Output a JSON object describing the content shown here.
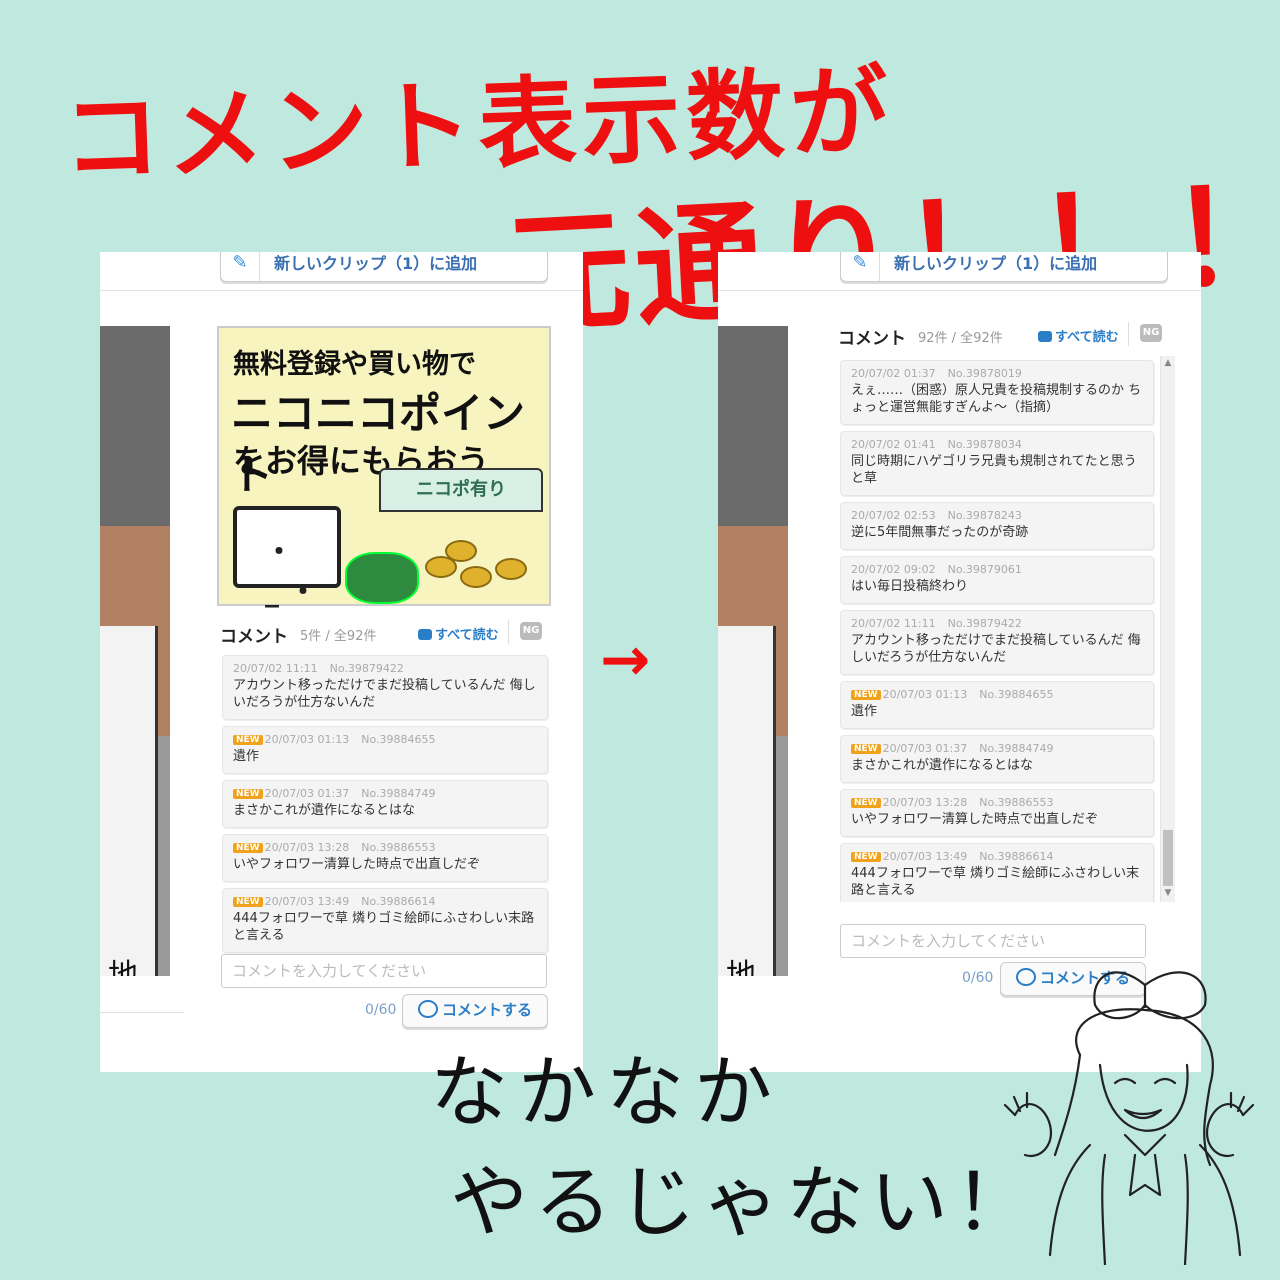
{
  "headline": {
    "line1": "コメント表示数が",
    "line2": "元通り！！！"
  },
  "panels": {
    "left": {
      "clip_label": "新しいクリップ（1）に追加",
      "manga_text": "地獄のそこで",
      "ad": {
        "line1": "無料登録や買い物で",
        "line2": "ニコニコポイント",
        "line3": "をお得にもらおう",
        "stall": "ニコポ有り"
      },
      "comment_header": {
        "label": "コメント",
        "count": "5件",
        "total": " / 全92件",
        "read_all": "すべて読む",
        "ng": "NG"
      },
      "comments": [
        {
          "date": "20/07/02 11:11",
          "no": "No.39879422",
          "new": "",
          "text": "アカウント移っただけでまだ投稿しているんだ 侮しいだろうが仕方ないんだ"
        },
        {
          "date": "20/07/03 01:13",
          "no": "No.39884655",
          "new": "NEW",
          "text": "遺作"
        },
        {
          "date": "20/07/03 01:37",
          "no": "No.39884749",
          "new": "NEW",
          "text": "まさかこれが遺作になるとはな"
        },
        {
          "date": "20/07/03 13:28",
          "no": "No.39886553",
          "new": "NEW",
          "text": "いやフォロワー清算した時点で出直しだぞ"
        },
        {
          "date": "20/07/03 13:49",
          "no": "No.39886614",
          "new": "NEW",
          "text": "444フォロワーで草 燐りゴミ絵師にふさわしい末路と言える"
        }
      ],
      "input_placeholder": "コメントを入力してください",
      "counter": "0/60",
      "submit": "コメントする"
    },
    "right": {
      "clip_label": "新しいクリップ（1）に追加",
      "manga_text": "地獄のそこで",
      "comment_header": {
        "label": "コメント",
        "count": "92件",
        "total": " / 全92件",
        "read_all": "すべて読む",
        "ng": "NG"
      },
      "comments": [
        {
          "date": "20/07/02 01:37",
          "no": "No.39878019",
          "new": "",
          "text": "えぇ……（困惑）原人兄貴を投稿規制するのか ちょっと運営無能すぎんよ～（指摘）"
        },
        {
          "date": "20/07/02 01:41",
          "no": "No.39878034",
          "new": "",
          "text": "同じ時期にハゲゴリラ兄貴も規制されてたと思うと草"
        },
        {
          "date": "20/07/02 02:53",
          "no": "No.39878243",
          "new": "",
          "text": "逆に5年間無事だったのが奇跡"
        },
        {
          "date": "20/07/02 09:02",
          "no": "No.39879061",
          "new": "",
          "text": "はい毎日投稿終わり"
        },
        {
          "date": "20/07/02 11:11",
          "no": "No.39879422",
          "new": "",
          "text": "アカウント移っただけでまだ投稿しているんだ 侮しいだろうが仕方ないんだ"
        },
        {
          "date": "20/07/03 01:13",
          "no": "No.39884655",
          "new": "NEW",
          "text": "遺作"
        },
        {
          "date": "20/07/03 01:37",
          "no": "No.39884749",
          "new": "NEW",
          "text": "まさかこれが遺作になるとはな"
        },
        {
          "date": "20/07/03 13:28",
          "no": "No.39886553",
          "new": "NEW",
          "text": "いやフォロワー清算した時点で出直しだぞ"
        },
        {
          "date": "20/07/03 13:49",
          "no": "No.39886614",
          "new": "NEW",
          "text": "444フォロワーで草 燐りゴミ絵師にふさわしい末路と言える"
        }
      ],
      "input_placeholder": "コメントを入力してください",
      "counter": "0/60",
      "submit": "コメントする"
    }
  },
  "bottom_text": {
    "line1": "なかなか",
    "line2": "やるじゃない！"
  },
  "colors": {
    "background": "#bfe8df",
    "headline": "#ee1010",
    "link": "#2a7ec8",
    "new_badge": "#f0a21a"
  },
  "icons": {
    "arrow": "right-arrow-icon",
    "character": "character-illustration"
  }
}
